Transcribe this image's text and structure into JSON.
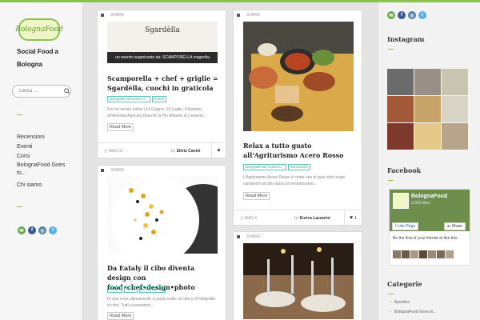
{
  "site": {
    "logo_text": "BolognaFood",
    "tagline": "Social Food a Bologna"
  },
  "search": {
    "placeholder": "Cerca ..."
  },
  "nav": [
    "Recensioni",
    "Eventi",
    "Corsi",
    "BolognaFood Goes to...",
    "Chi siamo"
  ],
  "social_icons": [
    "email-icon",
    "facebook-icon",
    "instagram-icon",
    "twitter-icon"
  ],
  "cards": [
    {
      "header": "SHARE",
      "image_caption": "un evento organizzato da: SCAMPORELLA magnolia",
      "image_brand": "Sgardèlla",
      "title": "Scamporella + chef + griglie = Sgardèlla, cuochi in graticola",
      "tags": [
        "BolognaFood Goes to...",
        "Eventi"
      ],
      "excerpt": "Per tre serate estive (14 Giugno, 19 Luglio, 9 Agosto), all'Azienda Agricola Giunchi (a Pio Marano di Cesena)...",
      "more": "Read More",
      "date": "MAG 31",
      "author_prefix": "by",
      "author": "Silvia Canini",
      "likes": ""
    },
    {
      "header": "SHARE",
      "title": "Da Eataly il cibo diventa design con food•chef•design•photo",
      "tags": [
        "Eventi",
        "News",
        "presentazioni"
      ],
      "excerpt": "Di due cose ultimamente si parla molto: di cibo e di fotografia di cibo. Tutti si possiamo...",
      "more": "Read More"
    },
    {
      "header": "SHARE",
      "title": "Relax a tutto gusto all'Agriturismo Acero Rosso",
      "tags": [
        "BolognaFood Goes to...",
        "Recensioni"
      ],
      "excerpt": "L'Agriturismo Acero Rosso è come uno di quei dolci sogni campestri ad alto tasso di romanticismo...",
      "more": "Read More",
      "date": "MAG 6",
      "author_prefix": "by",
      "author": "Enrica Lazzarini",
      "likes": "1"
    },
    {
      "header": "SHARE"
    }
  ],
  "sidebar_right": {
    "instagram_title": "Instagram",
    "facebook_title": "Facebook",
    "fb_page_name": "BolognaFood",
    "fb_likes": "3,900 likes",
    "fb_like_button": "Like Page",
    "fb_share_button": "Share",
    "fb_friends_text": "Be the first of your friends to like this",
    "categories_title": "Categorie",
    "categories": [
      "Aperitivo",
      "BolognaFood Goes to..."
    ]
  },
  "colors": {
    "accent": "#8cc152",
    "tag": "#5cc4b6",
    "email": "#6aa84f",
    "facebook": "#3b5998",
    "instagram": "#517fa4",
    "twitter": "#55acee"
  }
}
